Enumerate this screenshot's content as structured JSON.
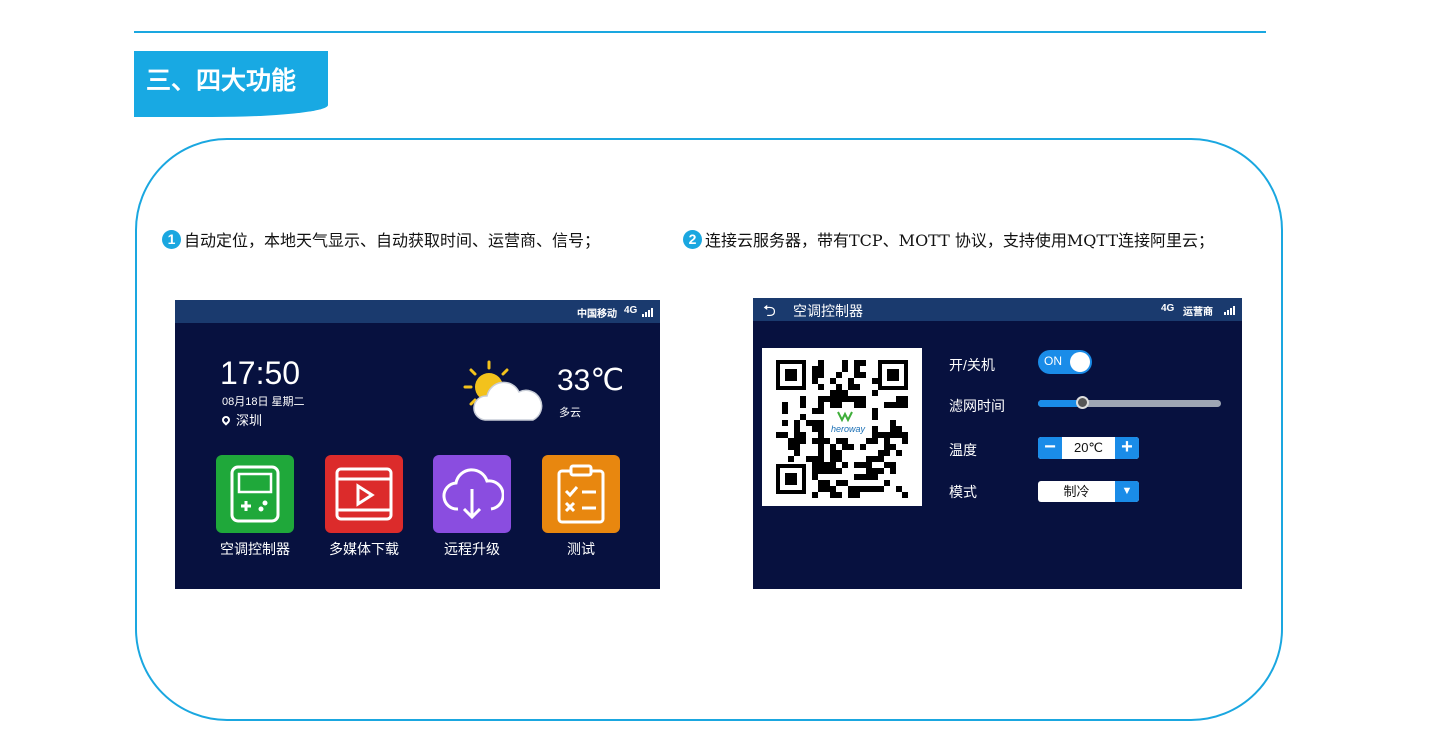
{
  "section_title": "三、四大功能",
  "features": [
    {
      "num": "1",
      "text": "自动定位，本地天气显示、自动获取时间、运营商、信号；"
    },
    {
      "num": "2",
      "text": "连接云服务器，带有TCP、MOTT 协议，支持使用MQTT连接阿里云；"
    }
  ],
  "home_screen": {
    "carrier": "中国移动",
    "network": "4G",
    "time": "17:50",
    "date": "08月18日 星期二",
    "city": "深圳",
    "temperature": "33℃",
    "condition": "多云",
    "apps": [
      {
        "label": "空调控制器",
        "color": "#1fa83a",
        "icon": "controller-icon"
      },
      {
        "label": "多媒体下载",
        "color": "#dc2b2b",
        "icon": "play-icon"
      },
      {
        "label": "远程升级",
        "color": "#8a4de0",
        "icon": "cloud-download-icon"
      },
      {
        "label": "测试",
        "color": "#e8870f",
        "icon": "clipboard-icon"
      }
    ]
  },
  "ac_screen": {
    "title": "空调控制器",
    "network": "4G",
    "carrier": "运营商",
    "qr_logo": "heroway",
    "power_label": "开/关机",
    "power_state": "ON",
    "filter_label": "滤网时间",
    "filter_level": 0.24,
    "temp_label": "温度",
    "temp_value": "20℃",
    "mode_label": "模式",
    "mode_value": "制冷"
  },
  "colors": {
    "accent": "#1aa7e0",
    "screen_bg": "#07113f",
    "statusbar": "#1a3a6e",
    "control_blue": "#1a8ce8"
  }
}
